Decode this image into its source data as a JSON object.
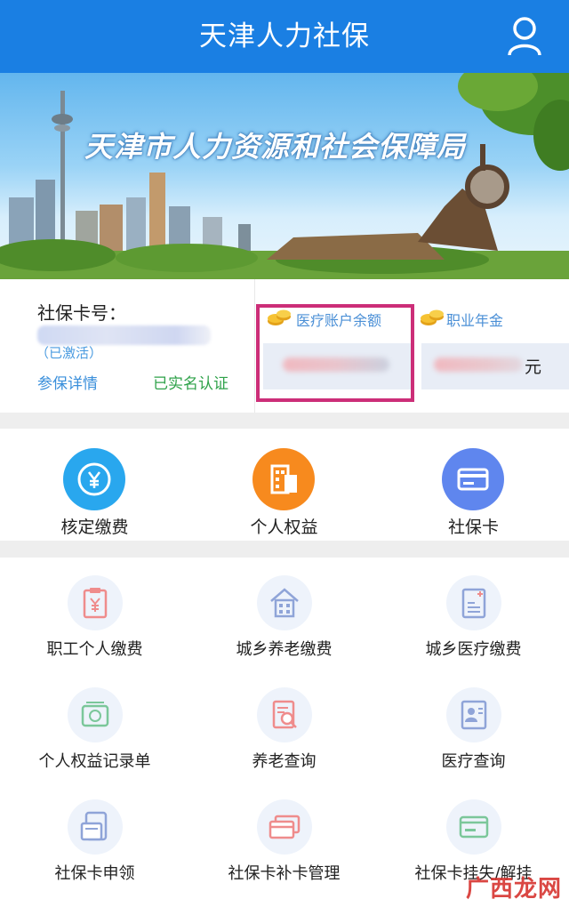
{
  "header": {
    "title": "天津人力社保"
  },
  "banner": {
    "text": "天津市人力资源和社会保障局"
  },
  "card": {
    "number_label": "社保卡号：",
    "status": "（已激活）",
    "detail_link": "参保详情",
    "verified": "已实名认证",
    "medical_label": "医疗账户余额",
    "annuity_label": "职业年金",
    "unit": "元"
  },
  "quick": [
    {
      "label": "核定缴费",
      "icon": "yuan-icon",
      "color": "#29a7ee"
    },
    {
      "label": "个人权益",
      "icon": "building-icon",
      "color": "#f78a1e"
    },
    {
      "label": "社保卡",
      "icon": "card-icon",
      "color": "#5f86ee"
    }
  ],
  "grid": [
    {
      "label": "职工个人缴费",
      "icon": "clipboard-yuan-icon"
    },
    {
      "label": "城乡养老缴费",
      "icon": "house-icon"
    },
    {
      "label": "城乡医疗缴费",
      "icon": "medical-bill-icon"
    },
    {
      "label": "个人权益记录单",
      "icon": "money-record-icon"
    },
    {
      "label": "养老查询",
      "icon": "document-search-icon"
    },
    {
      "label": "医疗查询",
      "icon": "profile-document-icon"
    },
    {
      "label": "社保卡申领",
      "icon": "card-apply-icon"
    },
    {
      "label": "社保卡补卡管理",
      "icon": "card-replace-icon"
    },
    {
      "label": "社保卡挂失/解挂",
      "icon": "card-lock-icon"
    }
  ],
  "watermark": "广西龙网"
}
